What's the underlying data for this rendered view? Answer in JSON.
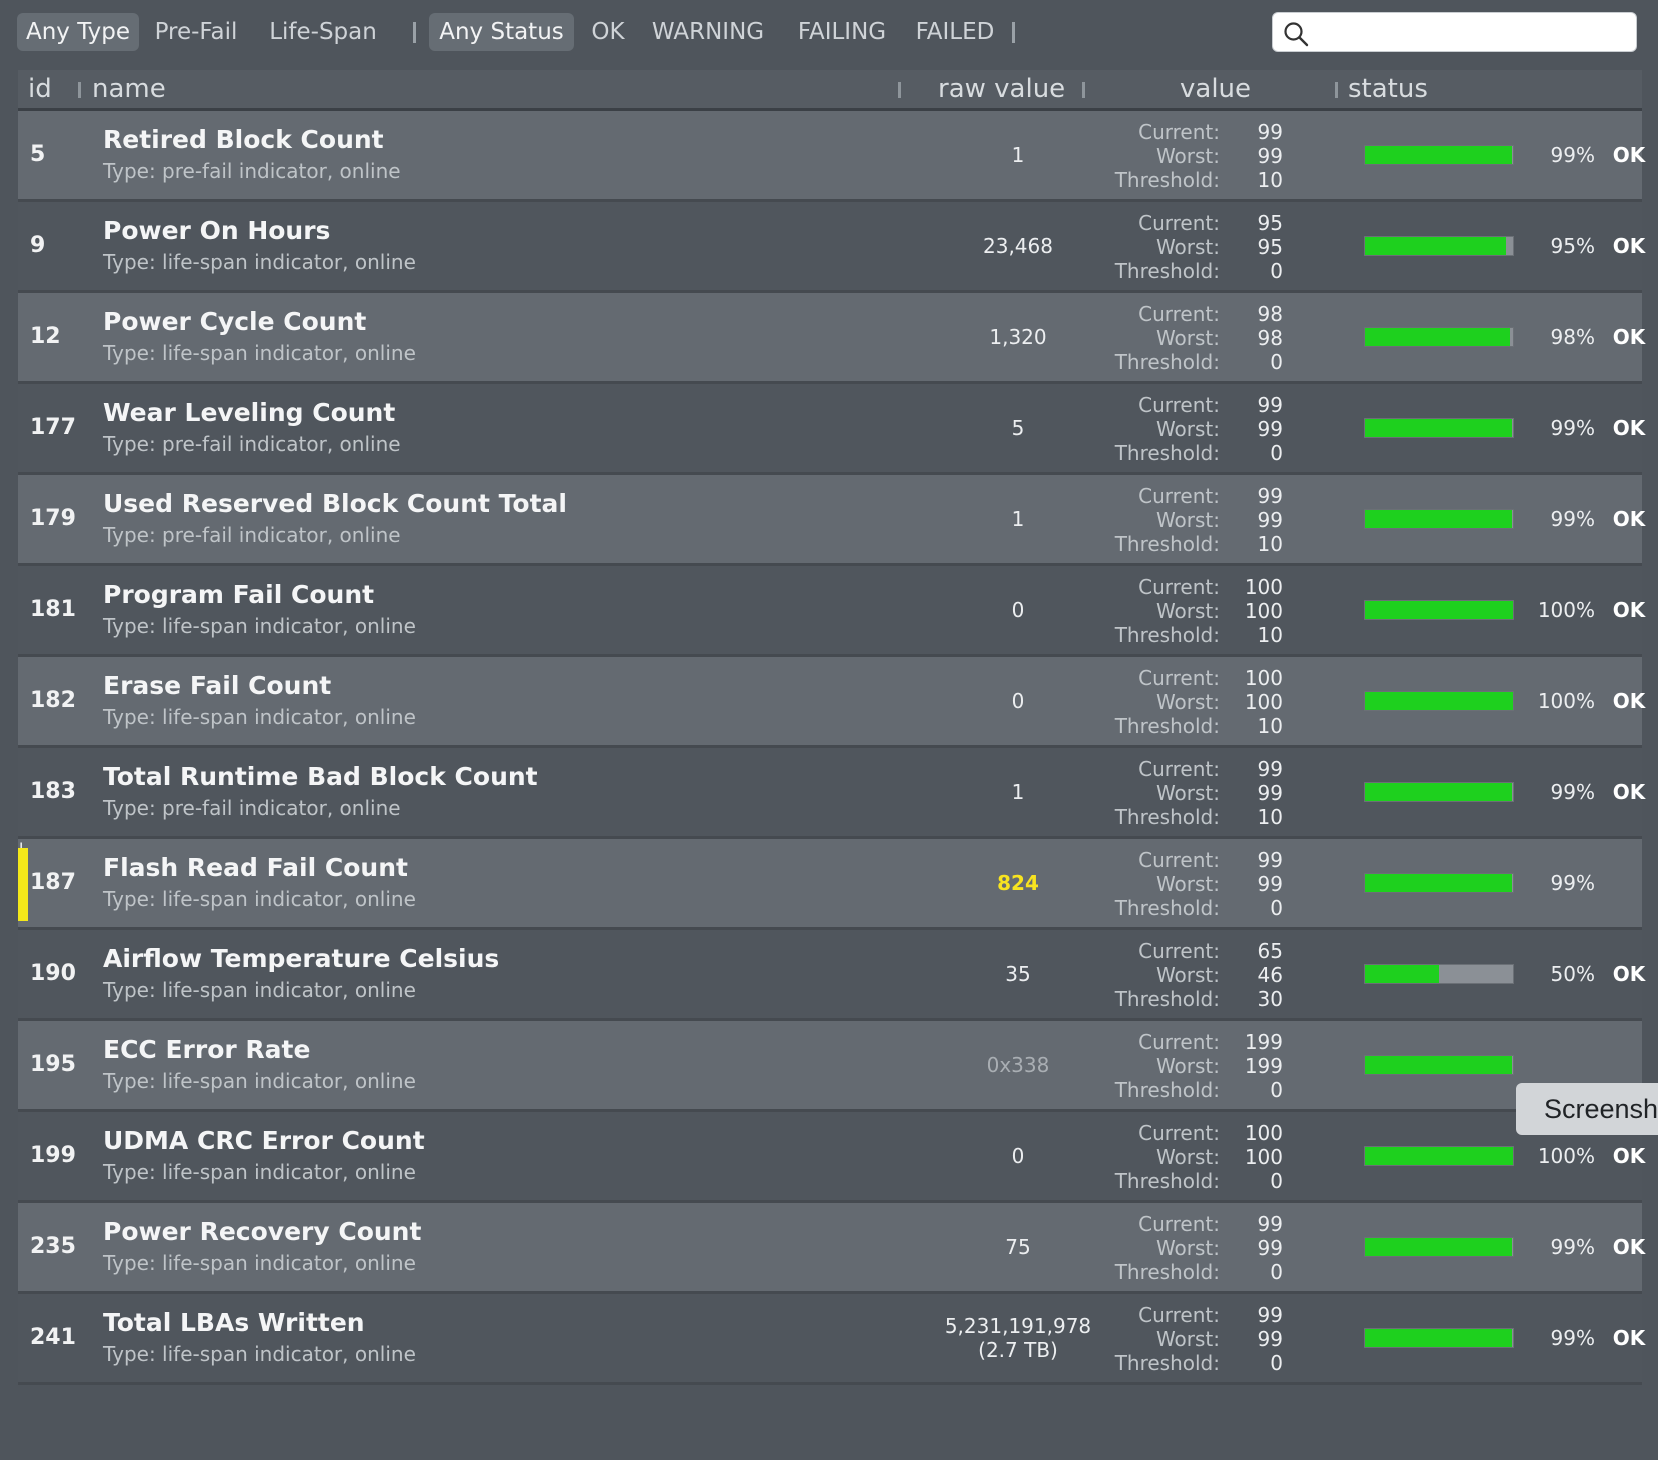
{
  "filters": {
    "type": [
      "Any Type",
      "Pre-Fail",
      "Life-Span"
    ],
    "status": [
      "Any Status",
      "OK",
      "WARNING",
      "FAILING",
      "FAILED"
    ],
    "active_type": "Any Type",
    "active_status": "Any Status"
  },
  "search": {
    "value": "",
    "icon": "search-icon"
  },
  "columns": {
    "id": "id",
    "name": "name",
    "raw": "raw value",
    "value": "value",
    "status": "status"
  },
  "value_labels": {
    "current": "Current:",
    "worst": "Worst:",
    "threshold": "Threshold:"
  },
  "colors": {
    "ok_bar": "#1ed01e",
    "warning_marker": "#f4e81a",
    "warning_text": "#f7e320",
    "warning_icon": "#f2a900"
  },
  "rows": [
    {
      "id": "5",
      "name": "Retired Block Count",
      "type": "Type: pre-fail indicator, online",
      "raw": "1",
      "raw2": "",
      "current": "99",
      "worst": "99",
      "threshold": "10",
      "percent": "99%",
      "level": 0.99,
      "status": "OK"
    },
    {
      "id": "9",
      "name": "Power On Hours",
      "type": "Type: life-span indicator, online",
      "raw": "23,468",
      "raw2": "",
      "current": "95",
      "worst": "95",
      "threshold": "0",
      "percent": "95%",
      "level": 0.95,
      "status": "OK"
    },
    {
      "id": "12",
      "name": "Power Cycle Count",
      "type": "Type: life-span indicator, online",
      "raw": "1,320",
      "raw2": "",
      "current": "98",
      "worst": "98",
      "threshold": "0",
      "percent": "98%",
      "level": 0.98,
      "status": "OK"
    },
    {
      "id": "177",
      "name": "Wear Leveling Count",
      "type": "Type: pre-fail indicator, online",
      "raw": "5",
      "raw2": "",
      "current": "99",
      "worst": "99",
      "threshold": "0",
      "percent": "99%",
      "level": 0.99,
      "status": "OK"
    },
    {
      "id": "179",
      "name": "Used Reserved Block Count Total",
      "type": "Type: pre-fail indicator, online",
      "raw": "1",
      "raw2": "",
      "current": "99",
      "worst": "99",
      "threshold": "10",
      "percent": "99%",
      "level": 0.99,
      "status": "OK"
    },
    {
      "id": "181",
      "name": "Program Fail Count",
      "type": "Type: life-span indicator, online",
      "raw": "0",
      "raw2": "",
      "current": "100",
      "worst": "100",
      "threshold": "10",
      "percent": "100%",
      "level": 1.0,
      "status": "OK"
    },
    {
      "id": "182",
      "name": "Erase Fail Count",
      "type": "Type: life-span indicator, online",
      "raw": "0",
      "raw2": "",
      "current": "100",
      "worst": "100",
      "threshold": "10",
      "percent": "100%",
      "level": 1.0,
      "status": "OK"
    },
    {
      "id": "183",
      "name": "Total Runtime Bad Block Count",
      "type": "Type: pre-fail indicator, online",
      "raw": "1",
      "raw2": "",
      "current": "99",
      "worst": "99",
      "threshold": "10",
      "percent": "99%",
      "level": 0.99,
      "status": "OK"
    },
    {
      "id": "187",
      "name": "Flash Read Fail Count",
      "type": "Type: life-span indicator, online",
      "raw": "824",
      "raw2": "",
      "current": "99",
      "worst": "99",
      "threshold": "0",
      "percent": "99%",
      "level": 0.99,
      "status": "",
      "warning": true,
      "status_icon": "warning-icon",
      "status_icon_glyph": "!"
    },
    {
      "id": "190",
      "name": "Airflow Temperature Celsius",
      "type": "Type: life-span indicator, online",
      "raw": "35",
      "raw2": "",
      "current": "65",
      "worst": "46",
      "threshold": "30",
      "percent": "50%",
      "level": 0.5,
      "status": "OK"
    },
    {
      "id": "195",
      "name": "ECC Error Rate",
      "type": "Type: life-span indicator, online",
      "raw": "0x338",
      "raw2": "",
      "current": "199",
      "worst": "199",
      "threshold": "0",
      "percent": "",
      "level": 0.99,
      "status": "",
      "dim_raw": true
    },
    {
      "id": "199",
      "name": "UDMA CRC Error Count",
      "type": "Type: life-span indicator, online",
      "raw": "0",
      "raw2": "",
      "current": "100",
      "worst": "100",
      "threshold": "0",
      "percent": "100%",
      "level": 1.0,
      "status": "OK"
    },
    {
      "id": "235",
      "name": "Power Recovery Count",
      "type": "Type: life-span indicator, online",
      "raw": "75",
      "raw2": "",
      "current": "99",
      "worst": "99",
      "threshold": "0",
      "percent": "99%",
      "level": 0.99,
      "status": "OK"
    },
    {
      "id": "241",
      "name": "Total LBAs Written",
      "type": "Type: life-span indicator, online",
      "raw": "5,231,191,978",
      "raw2": "(2.7 TB)",
      "current": "99",
      "worst": "99",
      "threshold": "0",
      "percent": "99%",
      "level": 0.99,
      "status": "OK"
    }
  ],
  "tooltip": "Screensh"
}
